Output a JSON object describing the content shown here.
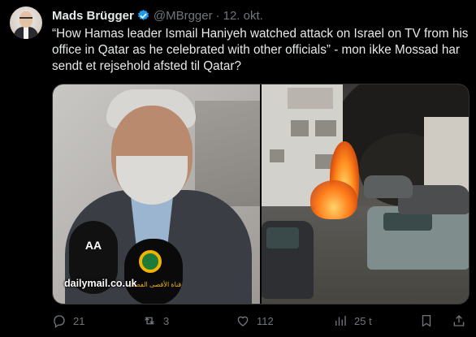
{
  "author": {
    "name": "Mads Brügger",
    "handle": "@MBrgger",
    "separator": "·",
    "date": "12. okt.",
    "verified": true
  },
  "tweet": {
    "text": "“How Hamas leader Ismail Haniyeh watched attack on Israel on TV from his office in Qatar as he celebrated with other officials” - mon ikke Mossad har sendt et rejsehold afsted til Qatar?"
  },
  "media": {
    "left_credit": "dailymail.co.uk",
    "left_mic_logo": "AA",
    "left_mic2_text": "قناة الأقصى الفضائية"
  },
  "actions": {
    "reply_count": "21",
    "retweet_count": "3",
    "like_count": "112",
    "views_count": "25 t"
  },
  "colors": {
    "background": "#000000",
    "primary_text": "#e7e9ea",
    "secondary_text": "#71767b",
    "verified_blue": "#1d9bf0"
  },
  "icons": [
    "verified-badge-icon",
    "reply-icon",
    "retweet-icon",
    "like-icon",
    "views-icon",
    "bookmark-icon",
    "share-icon"
  ]
}
